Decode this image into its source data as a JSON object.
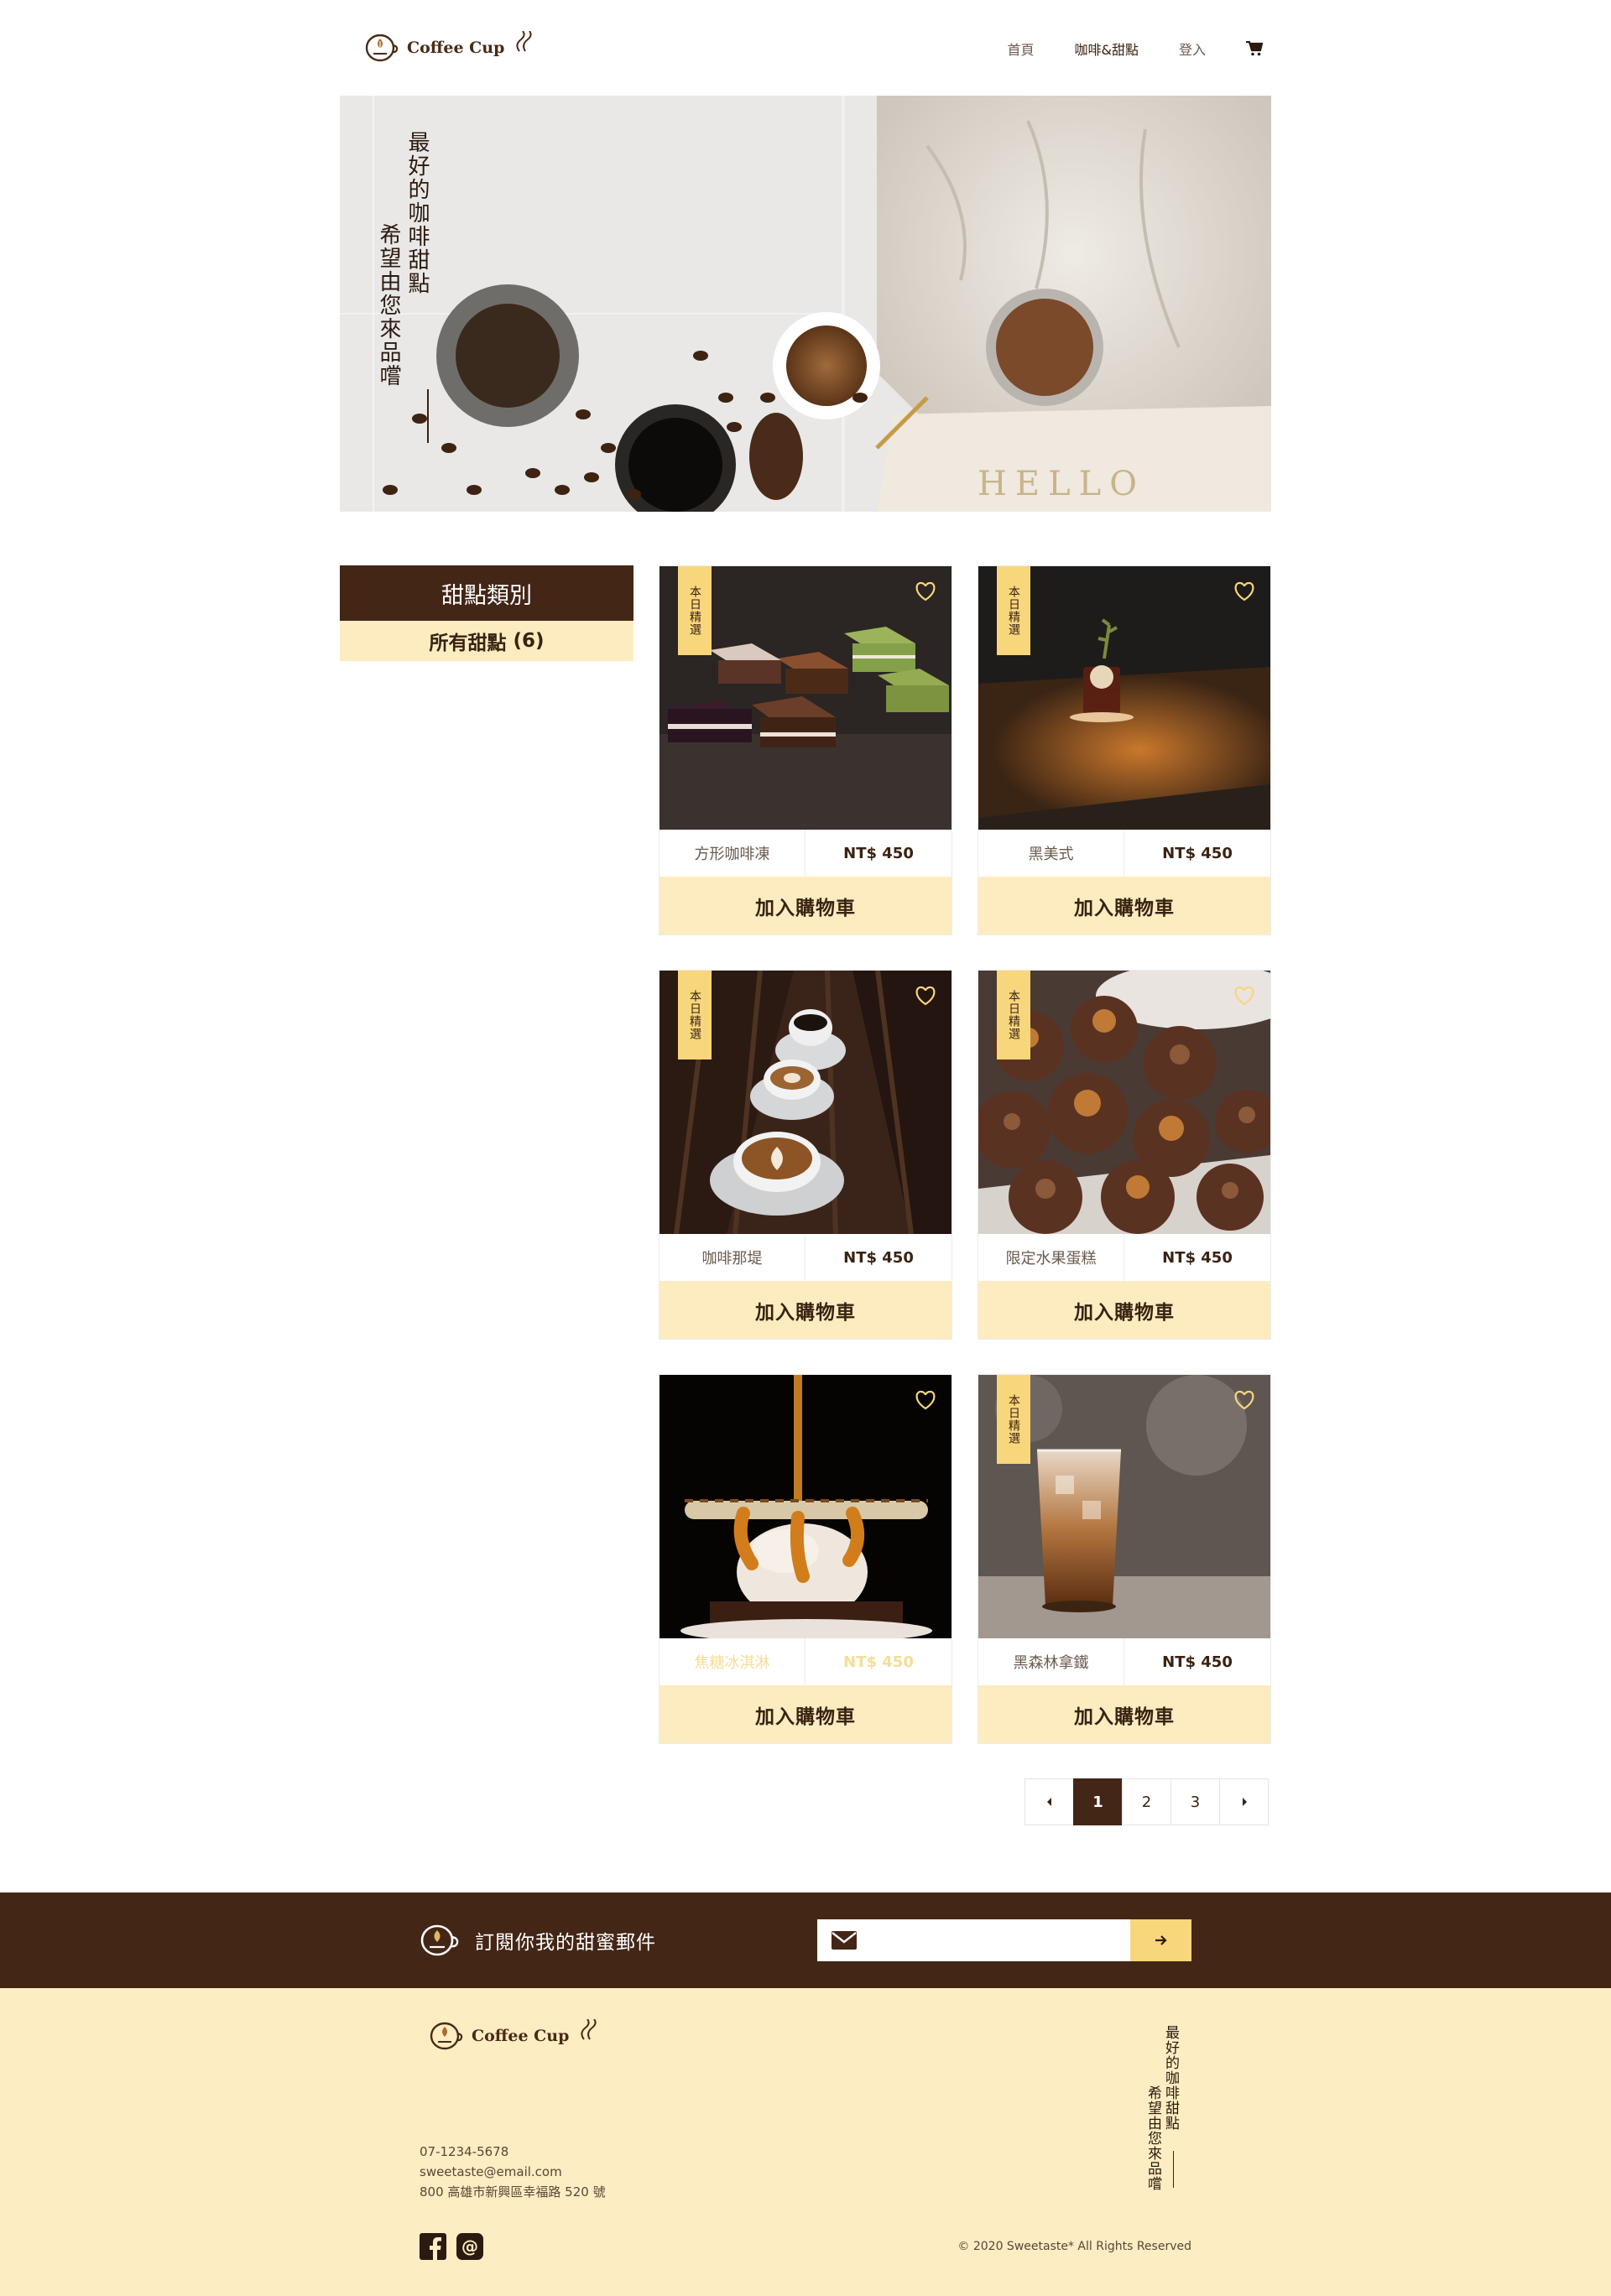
{
  "brand": {
    "name": "Coffee Cup"
  },
  "nav": {
    "home": "首頁",
    "products": "咖啡&甜點",
    "login": "登入"
  },
  "hero": {
    "line1": "最好的咖啡甜點",
    "line2": "希望由您來品嚐",
    "mug_text": "HELLO"
  },
  "sidebar": {
    "title": "甜點類別",
    "item_label": "所有甜點",
    "item_count": "(6)"
  },
  "products": [
    {
      "name": "方形咖啡凍",
      "price": "NT$ 450",
      "tag": "本日精選",
      "button": "加入購物車"
    },
    {
      "name": "黑美式",
      "price": "NT$ 450",
      "tag": "本日精選",
      "button": "加入購物車"
    },
    {
      "name": "咖啡那堤",
      "price": "NT$ 450",
      "tag": "本日精選",
      "button": "加入購物車"
    },
    {
      "name": "限定水果蛋糕",
      "price": "NT$ 450",
      "tag": "本日精選",
      "button": "加入購物車"
    },
    {
      "name": "焦糖冰淇淋",
      "price": "NT$ 450",
      "button": "加入購物車"
    },
    {
      "name": "黑森林拿鐵",
      "price": "NT$ 450",
      "tag": "本日精選",
      "button": "加入購物車"
    }
  ],
  "pagination": {
    "pages": [
      "1",
      "2",
      "3"
    ],
    "current": "1"
  },
  "subscribe": {
    "text": "訂閱你我的甜蜜郵件",
    "placeholder": ""
  },
  "footer": {
    "phone": "07-1234-5678",
    "email": "sweetaste@email.com",
    "address": "800 高雄市新興區幸福路 520 號",
    "copyright": "© 2020 Sweetaste* All Rights Reserved",
    "slogan1": "最好的咖啡甜點",
    "slogan2": "希望由您來品嚐"
  },
  "colors": {
    "brown": "#432616",
    "yellow": "#f8d67c",
    "cream": "#fdecbf"
  },
  "icons": [
    "cup-logo-icon",
    "steam-icon",
    "cart-icon",
    "heart-icon",
    "envelope-icon",
    "arrow-right-icon",
    "caret-left-icon",
    "caret-right-icon",
    "facebook-icon",
    "at-icon"
  ]
}
